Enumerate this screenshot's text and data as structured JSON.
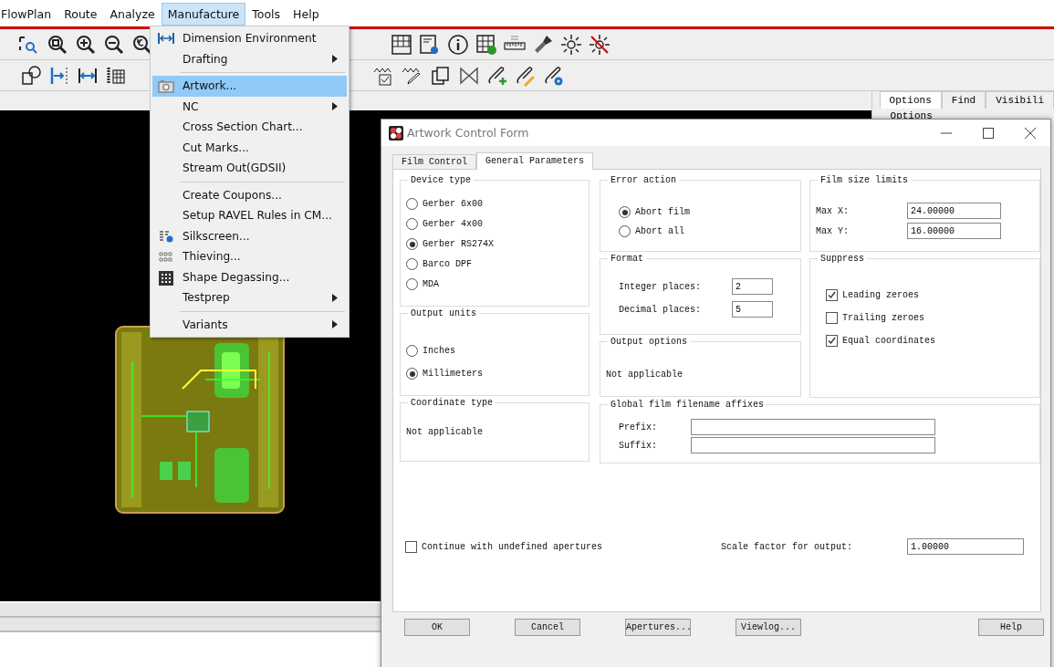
{
  "menu_bar": [
    {
      "label": "FlowPlan",
      "selected": false
    },
    {
      "label": "Route",
      "selected": false
    },
    {
      "label": "Analyze",
      "selected": false
    },
    {
      "label": "Manufacture",
      "selected": true
    },
    {
      "label": "Tools",
      "selected": false
    },
    {
      "label": "Help",
      "selected": false
    }
  ],
  "manufacture_menu": [
    {
      "kind": "item",
      "label": "Dimension Environment",
      "selected": false,
      "submenu": false
    },
    {
      "kind": "item",
      "label": "Drafting",
      "selected": false,
      "submenu": true
    },
    {
      "kind": "separator"
    },
    {
      "kind": "item",
      "label": "Artwork...",
      "selected": true,
      "submenu": false
    },
    {
      "kind": "item",
      "label": "NC",
      "selected": false,
      "submenu": true
    },
    {
      "kind": "item",
      "label": "Cross Section Chart...",
      "selected": false,
      "submenu": false
    },
    {
      "kind": "item",
      "label": "Cut Marks...",
      "selected": false,
      "submenu": false
    },
    {
      "kind": "item",
      "label": "Stream Out(GDSII)",
      "selected": false,
      "submenu": false
    },
    {
      "kind": "separator"
    },
    {
      "kind": "item",
      "label": "Create Coupons...",
      "selected": false,
      "submenu": false
    },
    {
      "kind": "item",
      "label": "Setup RAVEL Rules in CM...",
      "selected": false,
      "submenu": false
    },
    {
      "kind": "item",
      "label": "Silkscreen...",
      "selected": false,
      "submenu": false
    },
    {
      "kind": "item",
      "label": "Thieving...",
      "selected": false,
      "submenu": false
    },
    {
      "kind": "item",
      "label": "Shape Degassing...",
      "selected": false,
      "submenu": false
    },
    {
      "kind": "item",
      "label": "Testprep",
      "selected": false,
      "submenu": true
    },
    {
      "kind": "separator"
    },
    {
      "kind": "item",
      "label": "Variants",
      "selected": false,
      "submenu": true
    }
  ],
  "side_panel": {
    "tabs": [
      {
        "label": "Options",
        "selected": true
      },
      {
        "label": "Find",
        "selected": false
      },
      {
        "label": "Visibili",
        "selected": false
      }
    ],
    "heading": "Options"
  },
  "dialog": {
    "title": "Artwork Control Form",
    "tabs": [
      {
        "label": "Film Control",
        "selected": false
      },
      {
        "label": "General Parameters",
        "selected": true
      }
    ],
    "device_type": {
      "title": "Device type",
      "options": [
        {
          "label": "Gerber 6x00",
          "selected": false
        },
        {
          "label": "Gerber 4x00",
          "selected": false
        },
        {
          "label": "Gerber RS274X",
          "selected": true
        },
        {
          "label": "Barco DPF",
          "selected": false
        },
        {
          "label": "MDA",
          "selected": false
        }
      ]
    },
    "output_units": {
      "title": "Output units",
      "options": [
        {
          "label": "Inches",
          "selected": false
        },
        {
          "label": "Millimeters",
          "selected": true
        }
      ]
    },
    "coordinate_type": {
      "title": "Coordinate type",
      "text": "Not applicable"
    },
    "error_action": {
      "title": "Error action",
      "options": [
        {
          "label": "Abort film",
          "selected": true
        },
        {
          "label": "Abort all",
          "selected": false
        }
      ]
    },
    "format": {
      "title": "Format",
      "fields": [
        {
          "label": "Integer places:",
          "value": "2"
        },
        {
          "label": "Decimal places:",
          "value": "5"
        }
      ]
    },
    "output_options": {
      "title": "Output options",
      "text": "Not applicable"
    },
    "film_size_limits": {
      "title": "Film size limits",
      "fields": [
        {
          "label": "Max X:",
          "value": "24.00000"
        },
        {
          "label": "Max Y:",
          "value": "16.00000"
        }
      ]
    },
    "suppress": {
      "title": "Suppress",
      "options": [
        {
          "label": "Leading zeroes",
          "checked": true
        },
        {
          "label": "Trailing zeroes",
          "checked": false
        },
        {
          "label": "Equal coordinates",
          "checked": true
        }
      ]
    },
    "filename_affixes": {
      "title": "Global film filename affixes",
      "fields": [
        {
          "label": "Prefix:"
        },
        {
          "label": "Suffix:"
        }
      ]
    },
    "continue_undefined": {
      "label": "Continue with undefined apertures",
      "checked": false
    },
    "scale_factor": {
      "label": "Scale factor for output:",
      "value": "1.00000"
    },
    "buttons": [
      "OK",
      "Cancel",
      "Apertures...",
      "Viewlog...",
      "Help"
    ]
  }
}
